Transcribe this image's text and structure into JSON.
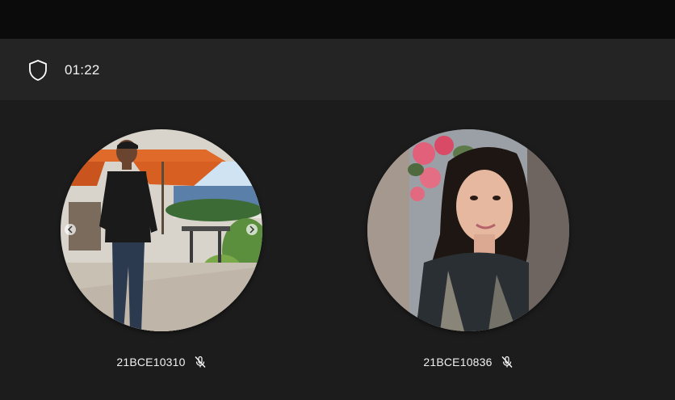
{
  "call": {
    "timer": "01:22",
    "security_icon": "shield-icon"
  },
  "participants": [
    {
      "id": "21BCE10310",
      "mic_icon": "mic-off-icon",
      "muted": true
    },
    {
      "id": "21BCE10836",
      "mic_icon": "mic-off-icon",
      "muted": true
    }
  ],
  "colors": {
    "topbar": "#0b0b0b",
    "callbar": "#242424",
    "stage": "#1c1c1c",
    "text": "#ffffff"
  }
}
